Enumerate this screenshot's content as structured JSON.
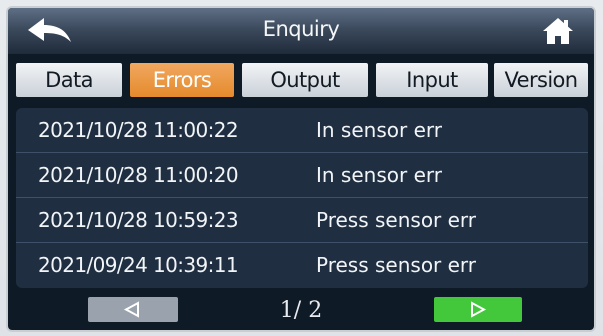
{
  "header": {
    "title": "Enquiry",
    "back_icon": "back-arrow-icon",
    "home_icon": "home-icon"
  },
  "tabs": [
    {
      "label": "Data",
      "active": false
    },
    {
      "label": "Errors",
      "active": true
    },
    {
      "label": "Output",
      "active": false
    },
    {
      "label": "Input",
      "active": false
    },
    {
      "label": "Version",
      "active": false
    }
  ],
  "error_log": [
    {
      "timestamp": "2021/10/28 11:00:22",
      "message": "In sensor err"
    },
    {
      "timestamp": "2021/10/28 11:00:20",
      "message": "In sensor err"
    },
    {
      "timestamp": "2021/10/28 10:59:23",
      "message": "Press sensor err"
    },
    {
      "timestamp": "2021/09/24 10:39:11",
      "message": "Press sensor err"
    }
  ],
  "pager": {
    "indicator": "1/ 2",
    "prev_icon": "triangle-left-icon",
    "next_icon": "triangle-right-icon"
  },
  "colors": {
    "active_tab": "#e58a2c",
    "next_button": "#42c83a",
    "prev_button": "#9aa3ad",
    "screen_bg": "#0f1a27",
    "list_bg": "#1f2e41"
  }
}
